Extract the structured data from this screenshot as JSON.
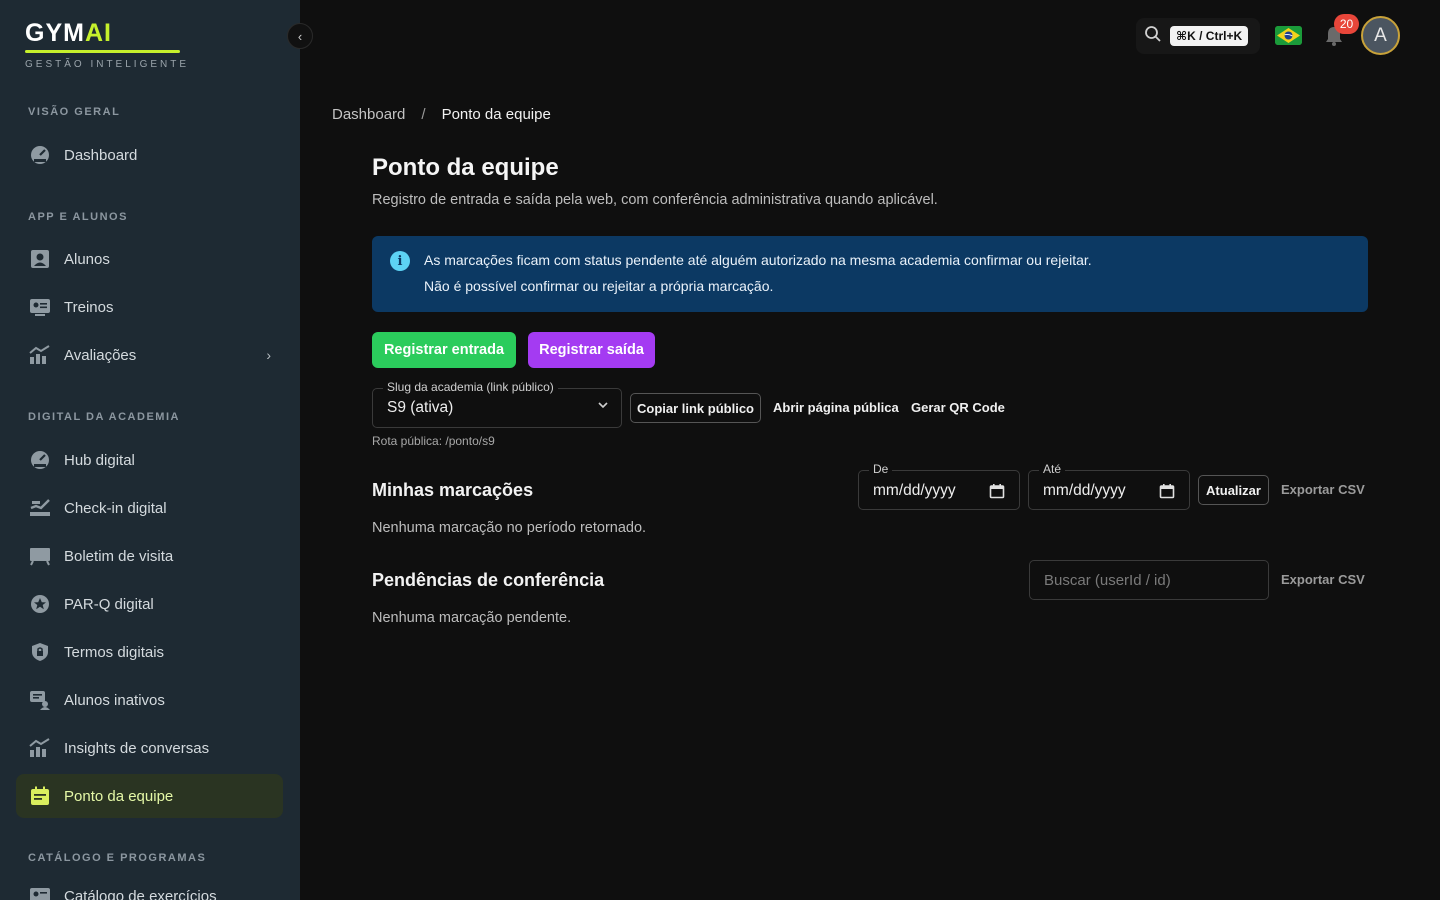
{
  "brand": {
    "name": "GYM",
    "name_accent": "AI",
    "tagline": "GESTÃO INTELIGENTE"
  },
  "sidebar": {
    "sections": [
      {
        "label": "VISÃO GERAL"
      },
      {
        "label": "APP E ALUNOS"
      },
      {
        "label": "DIGITAL DA ACADEMIA"
      },
      {
        "label": "CATÁLOGO E PROGRAMAS"
      }
    ],
    "items": [
      {
        "label": "Dashboard",
        "icon": "gauge-icon"
      },
      {
        "label": "Alunos",
        "icon": "user-icon"
      },
      {
        "label": "Treinos",
        "icon": "id-card-icon"
      },
      {
        "label": "Avaliações",
        "icon": "chart-icon"
      },
      {
        "label": "Hub digital",
        "icon": "gauge-icon"
      },
      {
        "label": "Check-in digital",
        "icon": "checkin-icon"
      },
      {
        "label": "Boletim de visita",
        "icon": "monitor-icon"
      },
      {
        "label": "PAR-Q digital",
        "icon": "star-badge-icon"
      },
      {
        "label": "Termos digitais",
        "icon": "shield-lock-icon"
      },
      {
        "label": "Alunos inativos",
        "icon": "chat-user-icon"
      },
      {
        "label": "Insights de conversas",
        "icon": "chart-icon"
      },
      {
        "label": "Ponto da equipe",
        "icon": "calendar-icon"
      },
      {
        "label": "Catálogo de exercícios",
        "icon": "id-card-icon"
      }
    ],
    "collapse_glyph": "‹"
  },
  "topbar": {
    "shortcut": "⌘K / Ctrl+K",
    "notifications_count": "20",
    "avatar_initial": "A"
  },
  "breadcrumb": {
    "root": "Dashboard",
    "sep": "/",
    "current": "Ponto da equipe"
  },
  "page": {
    "title": "Ponto da equipe",
    "subtitle": "Registro de entrada e saída pela web, com conferência administrativa quando aplicável."
  },
  "info": {
    "line1": "As marcações ficam com status pendente até alguém autorizado na mesma academia confirmar ou rejeitar.",
    "line2": "Não é possível confirmar ou rejeitar a própria marcação."
  },
  "actions": {
    "register_in": "Registrar entrada",
    "register_out": "Registrar saída"
  },
  "slug": {
    "label": "Slug da academia (link público)",
    "value": "S9 (ativa)",
    "copy_link": "Copiar link público",
    "open_page": "Abrir página pública",
    "qr_code": "Gerar QR Code",
    "route": "Rota pública: /ponto/s9"
  },
  "my_marks": {
    "title": "Minhas marcações",
    "from_label": "De",
    "to_label": "Até",
    "date_placeholder": "mm/dd/yyyy",
    "refresh": "Atualizar",
    "export": "Exportar CSV",
    "empty": "Nenhuma marcação no período retornado."
  },
  "pending": {
    "title": "Pendências de conferência",
    "search_placeholder": "Buscar (userId / id)",
    "export": "Exportar CSV",
    "empty": "Nenhuma marcação pendente."
  },
  "colors": {
    "accent": "#c6f02c",
    "sidebar_bg": "#1e2a33",
    "info_bg": "#0c3963",
    "green": "#2bcc5c",
    "purple": "#a43bf2",
    "badge": "#e8463a"
  }
}
